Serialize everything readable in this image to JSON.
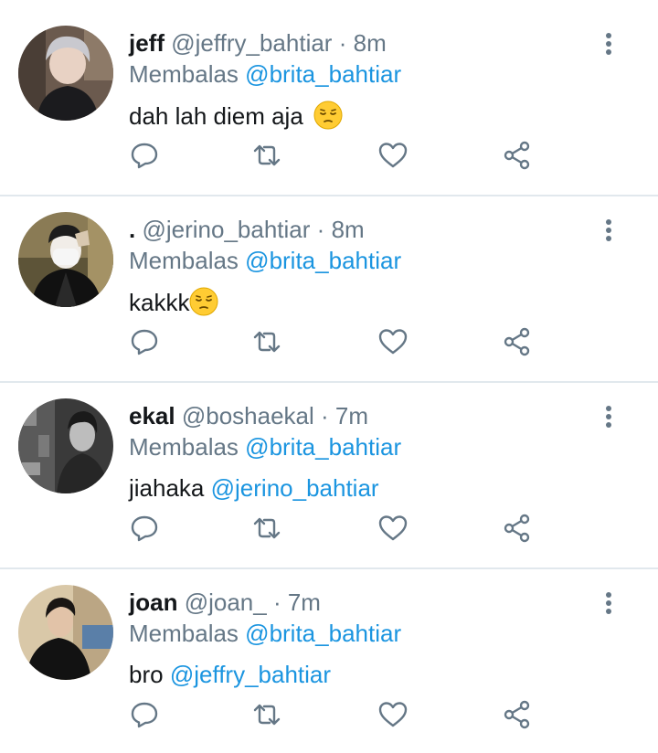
{
  "tweets": [
    {
      "name": "jeff",
      "handle": "@jeffry_bahtiar",
      "separator": "·",
      "time": "8m",
      "reply_prefix": "Membalas",
      "reply_to": "@brita_bahtiar",
      "text": "dah lah diem aja ",
      "body_mention": "",
      "emoji": "pensive-face",
      "avatar": {
        "bg": "#6b5a4e",
        "hair": "#c9c9cf",
        "shirt": "#1b1b1e",
        "skin": "#e8d2c4"
      }
    },
    {
      "name": ".",
      "handle": "@jerino_bahtiar",
      "separator": "·",
      "time": "8m",
      "reply_prefix": "Membalas",
      "reply_to": "@brita_bahtiar",
      "text": "kakkk",
      "body_mention": "",
      "emoji": "pensive-face",
      "avatar": {
        "bg": "#8a7b55",
        "hair": "#1c1c1c",
        "shirt": "#111111",
        "skin": "#f1ede8"
      }
    },
    {
      "name": "ekal",
      "handle": "@boshaekal",
      "separator": "·",
      "time": "7m",
      "reply_prefix": "Membalas",
      "reply_to": "@brita_bahtiar",
      "text": "jiahaka ",
      "body_mention": "@jerino_bahtiar",
      "emoji": "",
      "avatar": {
        "bg": "#3a3a3a",
        "hair": "#1a1a1a",
        "shirt": "#262626",
        "skin": "#bdbdbd"
      }
    },
    {
      "name": "joan",
      "handle": "@joan_",
      "separator": "·",
      "time": "7m",
      "reply_prefix": "Membalas",
      "reply_to": "@brita_bahtiar",
      "text": "bro ",
      "body_mention": "@jeffry_bahtiar",
      "emoji": "",
      "avatar": {
        "bg": "#d9c8a8",
        "hair": "#1a1614",
        "shirt": "#121212",
        "skin": "#e2c3a8"
      }
    }
  ],
  "actions": {
    "reply_icon": "reply-icon",
    "retweet_icon": "retweet-icon",
    "like_icon": "like-icon",
    "share_icon": "share-icon",
    "more_icon": "more-options-icon"
  },
  "colors": {
    "text": "#14171a",
    "secondary": "#657786",
    "link": "#1b95e0",
    "divider": "#e1e8ed"
  }
}
